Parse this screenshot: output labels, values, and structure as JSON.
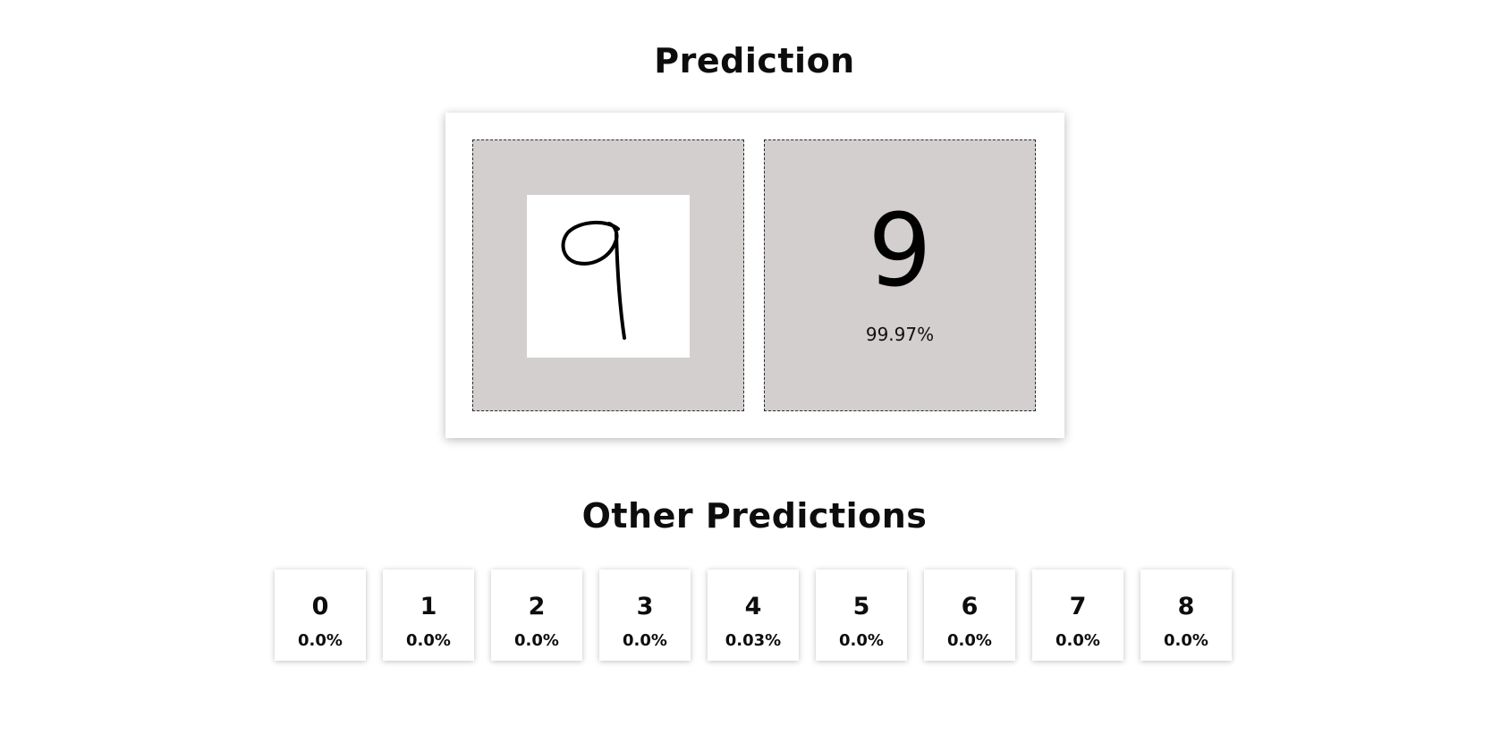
{
  "prediction": {
    "title": "Prediction",
    "predicted_digit": "9",
    "confidence": "99.97%"
  },
  "other_predictions": {
    "title": "Other Predictions",
    "items": [
      {
        "digit": "0",
        "pct": "0.0%"
      },
      {
        "digit": "1",
        "pct": "0.0%"
      },
      {
        "digit": "2",
        "pct": "0.0%"
      },
      {
        "digit": "3",
        "pct": "0.0%"
      },
      {
        "digit": "4",
        "pct": "0.03%"
      },
      {
        "digit": "5",
        "pct": "0.0%"
      },
      {
        "digit": "6",
        "pct": "0.0%"
      },
      {
        "digit": "7",
        "pct": "0.0%"
      },
      {
        "digit": "8",
        "pct": "0.0%"
      }
    ]
  }
}
